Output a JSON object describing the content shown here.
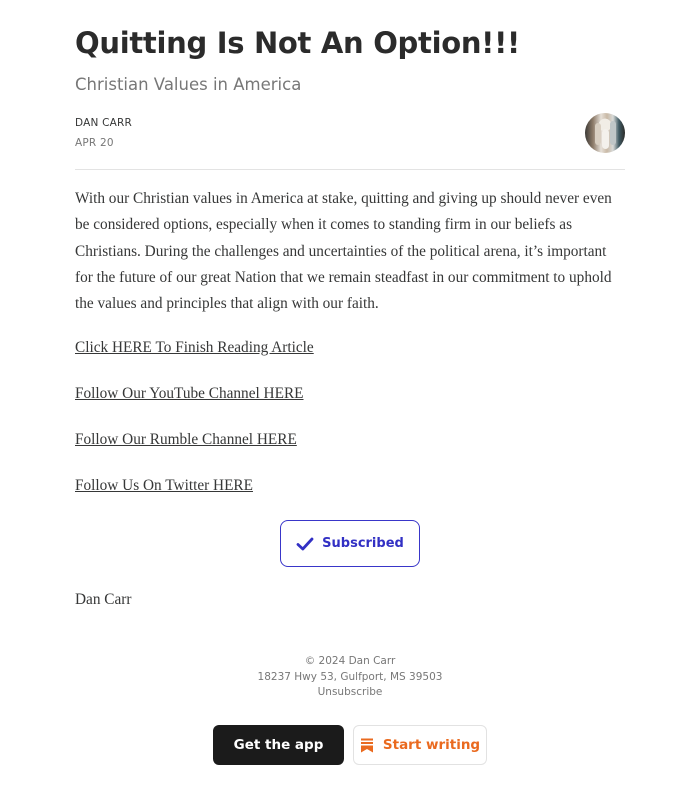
{
  "post": {
    "title": "Quitting Is Not An Option!!!",
    "subtitle": "Christian Values in America",
    "author": "DAN CARR",
    "date": "APR 20",
    "avatar_icon": "author-avatar-photo",
    "body": "With our Christian values in America at stake, quitting and giving up should never even be considered options, especially when it comes to standing firm in our beliefs as Christians. During the challenges and uncertainties of the political arena, it’s important for the future of our great Nation that we remain steadfast in our commitment to uphold the values and principles that align with our faith.",
    "links": [
      "Click HERE To Finish Reading Article",
      "Follow Our YouTube Channel HERE",
      "Follow Our Rumble Channel HERE",
      "Follow Us On Twitter HERE"
    ],
    "subscribe_button": {
      "label": "Subscribed",
      "icon": "checkmark-icon",
      "color": "#3230c4"
    },
    "signoff": "Dan Carr"
  },
  "footer": {
    "copyright": "© 2024 Dan Carr",
    "address": "18237 Hwy 53, Gulfport, MS 39503",
    "unsubscribe": "Unsubscribe",
    "get_app_label": "Get the app",
    "start_writing_label": "Start writing",
    "start_writing_icon": "substack-bookmark-icon",
    "accent_color": "#ea6a1f"
  }
}
